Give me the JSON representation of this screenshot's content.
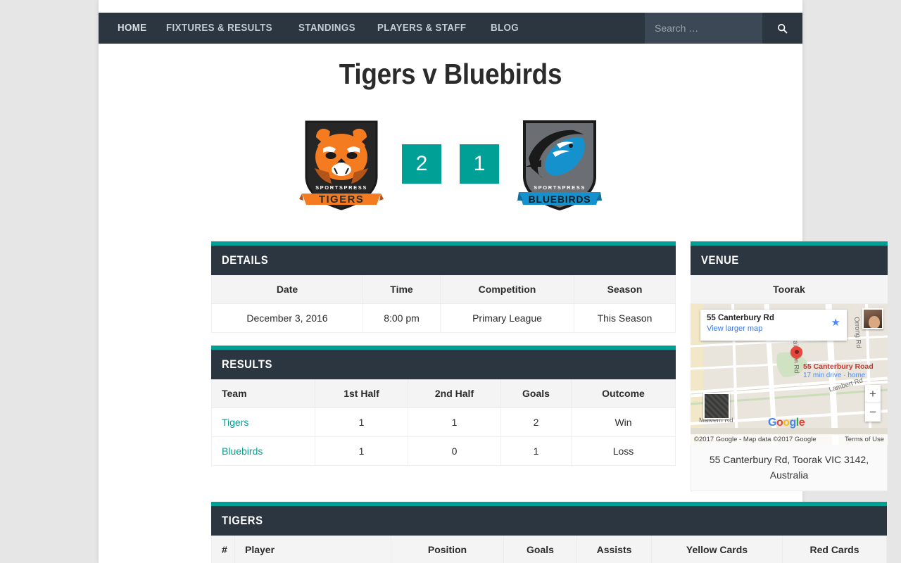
{
  "nav": {
    "items": [
      {
        "label": "HOME"
      },
      {
        "label": "FIXTURES & RESULTS"
      },
      {
        "label": "STANDINGS"
      },
      {
        "label": "PLAYERS & STAFF"
      },
      {
        "label": "BLOG"
      }
    ],
    "search_placeholder": "Search …",
    "search_value": "",
    "search_icon": "search-icon"
  },
  "title": "Tigers v Bluebirds",
  "scoreboard": {
    "home_team": "Tigers",
    "away_team": "Bluebirds",
    "home_logo_text_top": "SPORTSPRESS",
    "home_logo_text_bottom": "TIGERS",
    "away_logo_text_top": "SPORTSPRESS",
    "away_logo_text_bottom": "BLUEBIRDS",
    "home_score": "2",
    "away_score": "1"
  },
  "details": {
    "heading": "DETAILS",
    "columns": [
      "Date",
      "Time",
      "Competition",
      "Season"
    ],
    "row": [
      "December 3, 2016",
      "8:00 pm",
      "Primary League",
      "This Season"
    ]
  },
  "results": {
    "heading": "RESULTS",
    "columns": [
      "Team",
      "1st Half",
      "2nd Half",
      "Goals",
      "Outcome"
    ],
    "rows": [
      {
        "team": "Tigers",
        "first_half": "1",
        "second_half": "1",
        "goals": "2",
        "outcome": "Win"
      },
      {
        "team": "Bluebirds",
        "first_half": "1",
        "second_half": "0",
        "goals": "1",
        "outcome": "Loss"
      }
    ]
  },
  "venue": {
    "heading": "VENUE",
    "name": "Toorak",
    "address": "55 Canterbury Rd, Toorak VIC 3142, Australia",
    "map": {
      "card_title": "55 Canterbury Rd",
      "card_link": "View larger map",
      "pin_label": "55 Canterbury Road",
      "pin_sublabel": "17 min drive · home",
      "street_labels": [
        "Fairbairn Rd",
        "Lambert Rd",
        "Orrong Rd",
        "Malvern Rd"
      ],
      "google_letters": [
        "G",
        "o",
        "o",
        "g",
        "l",
        "e"
      ],
      "attribution": "©2017 Google - Map data ©2017 Google",
      "terms": "Terms of Use",
      "zoom_in": "+",
      "zoom_out": "−"
    }
  },
  "tigers": {
    "heading": "TIGERS",
    "columns": [
      "#",
      "Player",
      "Position",
      "Goals",
      "Assists",
      "Yellow Cards",
      "Red Cards"
    ]
  },
  "colors": {
    "accent": "#00a096",
    "dark": "#2b3641",
    "page_bg": "#e6e6e6",
    "link": "#00a096"
  }
}
